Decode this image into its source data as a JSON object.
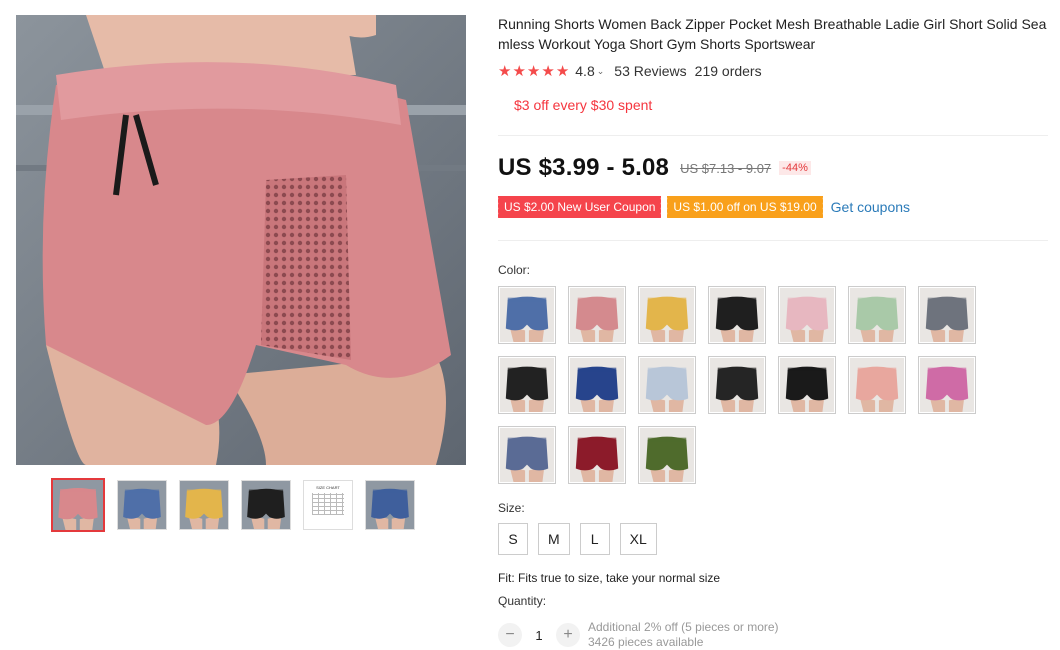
{
  "product": {
    "title": "Running Shorts Women Back Zipper Pocket Mesh Breathable Ladie Girl Short Solid Seamless Workout Yoga Short Gym Shorts Sportswear",
    "rating": "4.8",
    "rating_value": 4.8,
    "reviews": "53 Reviews",
    "orders": "219 orders",
    "promo": "$3 off every $30 spent",
    "price": "US $3.99 - 5.08",
    "original_price": "US $7.13 - 9.07",
    "discount": "-44%",
    "coupons": [
      {
        "label": "US $2.00 New User Coupon",
        "color": "#f5444c"
      },
      {
        "label": "US $1.00 off on US $19.00",
        "color": "#f9a01b"
      }
    ],
    "get_coupons": "Get coupons",
    "color_label": "Color:",
    "colors": [
      {
        "name": "blue",
        "hex": "#4f6fa8"
      },
      {
        "name": "pink",
        "hex": "#d48a8e"
      },
      {
        "name": "yellow",
        "hex": "#e3b54b"
      },
      {
        "name": "black",
        "hex": "#1f1f1f"
      },
      {
        "name": "light-pink",
        "hex": "#e7b7c0"
      },
      {
        "name": "mint",
        "hex": "#a9c9a8"
      },
      {
        "name": "gray",
        "hex": "#6e737d"
      },
      {
        "name": "black-2",
        "hex": "#222222"
      },
      {
        "name": "navy",
        "hex": "#27448c"
      },
      {
        "name": "light-blue",
        "hex": "#b8c6d8"
      },
      {
        "name": "black-3",
        "hex": "#252525"
      },
      {
        "name": "black-4",
        "hex": "#1a1a1a"
      },
      {
        "name": "peach",
        "hex": "#e8a79e"
      },
      {
        "name": "rose",
        "hex": "#cf6ba6"
      },
      {
        "name": "slate-blue",
        "hex": "#5a6b95"
      },
      {
        "name": "burgundy",
        "hex": "#8c1b2a"
      },
      {
        "name": "olive",
        "hex": "#4f6b2c"
      }
    ],
    "size_label": "Size:",
    "sizes": [
      "S",
      "M",
      "L",
      "XL"
    ],
    "fit": "Fit: Fits true to size, take your normal size",
    "quantity_label": "Quantity:",
    "quantity": "1",
    "quantity_note": "Additional 2% off (5 pieces or more)",
    "available": "3426 pieces available"
  },
  "gallery": {
    "main_color": "#d8888c",
    "thumbnails": [
      {
        "name": "pink",
        "hex": "#d8888c"
      },
      {
        "name": "blue",
        "hex": "#4f6fa8"
      },
      {
        "name": "yellow",
        "hex": "#e3b54b"
      },
      {
        "name": "black",
        "hex": "#1f1f1f"
      },
      {
        "name": "size-chart",
        "hex": "#ffffff",
        "caption": "SIZE CHART"
      },
      {
        "name": "blue-2",
        "hex": "#3f5f9c"
      }
    ]
  }
}
